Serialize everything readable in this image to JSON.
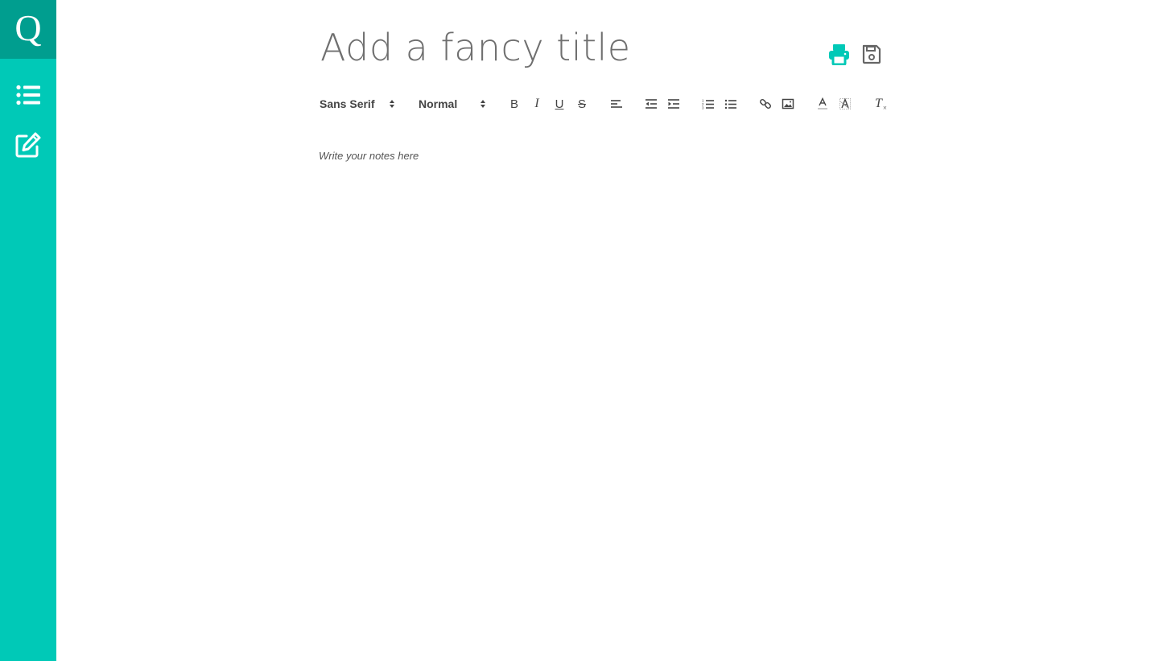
{
  "sidebar": {
    "logo_letter": "Q",
    "items": [
      {
        "name": "list-icon",
        "label": ""
      },
      {
        "name": "edit-note-icon",
        "label": ""
      }
    ]
  },
  "note": {
    "title_placeholder": "Add a fancy title",
    "body_placeholder": "Write your notes here"
  },
  "toolbar": {
    "font_family": "Sans Serif",
    "font_size": "Normal",
    "buttons": [
      "bold",
      "italic",
      "underline",
      "strikethrough",
      "align-left",
      "outdent",
      "indent",
      "ordered-list",
      "bullet-list",
      "link",
      "image",
      "text-color",
      "background-color",
      "clear-formatting"
    ],
    "bold_label": "B",
    "italic_label": "I",
    "underline_label": "U",
    "strike_label": "S",
    "clear_label": "T"
  },
  "actions": {
    "print_icon": "print-icon",
    "save_icon": "save-icon"
  },
  "colors": {
    "accent": "#00c9b7",
    "accent_dark": "#009e8f",
    "icon_gray": "#444444",
    "title_gray": "#6f6f6f"
  }
}
